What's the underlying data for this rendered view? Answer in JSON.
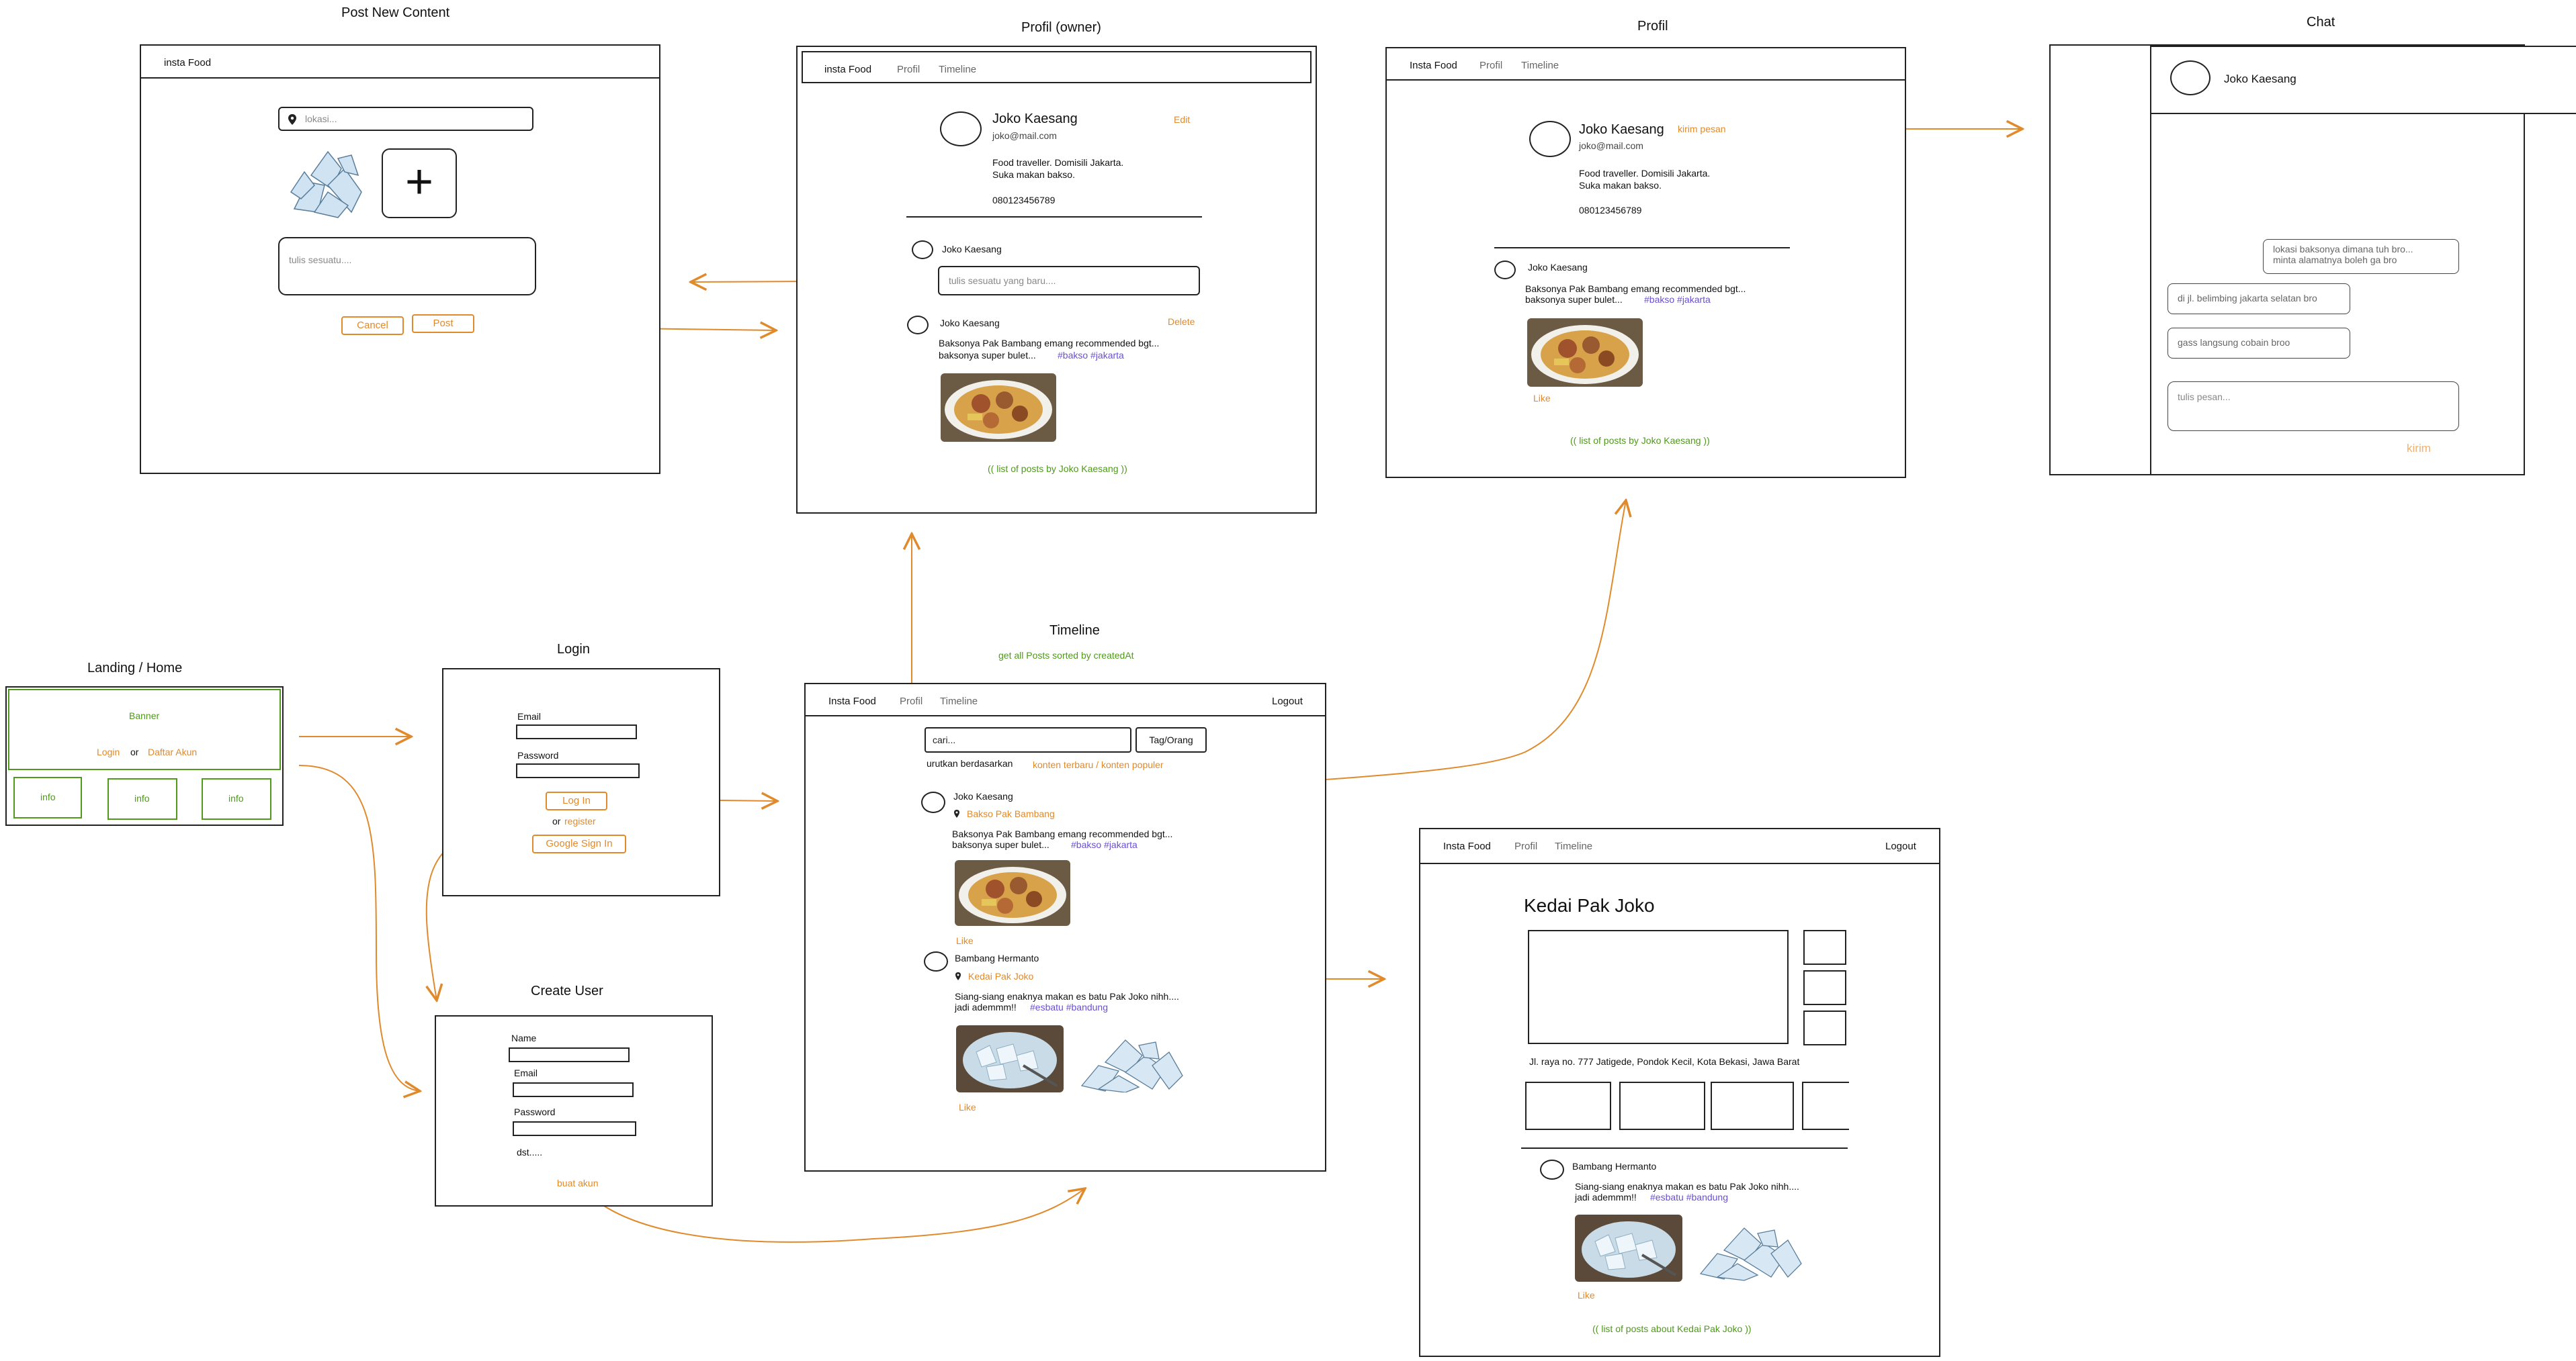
{
  "titles": {
    "post_new": "Post New Content",
    "profil_owner": "Profil (owner)",
    "profil": "Profil",
    "chat": "Chat",
    "landing": "Landing / Home",
    "login": "Login",
    "timeline": "Timeline",
    "timeline_note": "get all Posts sorted by createdAt",
    "create_user": "Create User"
  },
  "nav": {
    "brand_lower": "insta Food",
    "brand": "Insta Food",
    "profil": "Profil",
    "timeline": "Timeline",
    "logout": "Logout"
  },
  "post_new": {
    "location_placeholder": "lokasi...",
    "text_placeholder": "tulis sesuatu....",
    "plus": "+",
    "cancel": "Cancel",
    "post": "Post"
  },
  "profile": {
    "name": "Joko Kaesang",
    "email": "joko@mail.com",
    "bio1": "Food traveller. Domisili Jakarta.",
    "bio2": "Suka makan bakso.",
    "phone": "080123456789",
    "edit": "Edit",
    "kirim_pesan": "kirim pesan",
    "input_placeholder": "tulis sesuatu yang baru....",
    "delete": "Delete",
    "post_text1": "Baksonya Pak Bambang emang recommended bgt...",
    "post_text2": "baksonya super bulet...",
    "tags": "#bakso #jakarta",
    "like": "Like",
    "list_note": "(( list of posts by Joko Kaesang ))"
  },
  "chat": {
    "name": "Joko Kaesang",
    "msg1a": "lokasi baksonya dimana tuh bro...",
    "msg1b": "minta alamatnya boleh ga bro",
    "msg2": "di jl. belimbing jakarta selatan bro",
    "msg3": "gass langsung cobain broo",
    "input_placeholder": "tulis pesan...",
    "send": "kirim"
  },
  "landing": {
    "banner": "Banner",
    "login": "Login",
    "or": "or",
    "register": "Daftar Akun",
    "info": "info"
  },
  "login": {
    "email": "Email",
    "password": "Password",
    "login_btn": "Log In",
    "or": "or",
    "register": "register",
    "google": "Google Sign In"
  },
  "timeline": {
    "search_placeholder": "cari...",
    "tag_btn": "Tag/Orang",
    "sort_label": "urutkan berdasarkan",
    "sort_options": "konten terbaru / konten populer",
    "post1_user": "Joko Kaesang",
    "post1_loc": "Bakso Pak Bambang",
    "post1_text1": "Baksonya Pak Bambang emang recommended bgt...",
    "post1_text2": "baksonya super bulet...",
    "post1_tags": "#bakso #jakarta",
    "like": "Like",
    "post2_user": "Bambang Hermanto",
    "post2_loc": "Kedai Pak Joko",
    "post2_text1": "Siang-siang enaknya makan es batu Pak Joko nihh....",
    "post2_text2": "jadi ademmm!!",
    "post2_tags": "#esbatu #bandung"
  },
  "create_user": {
    "name": "Name",
    "email": "Email",
    "password": "Password",
    "etc": "dst.....",
    "submit": "buat akun"
  },
  "place": {
    "name": "Kedai Pak Joko",
    "address": "Jl. raya no. 777 Jatigede, Pondok Kecil, Kota Bekasi, Jawa Barat",
    "user": "Bambang Hermanto",
    "text1": "Siang-siang enaknya makan es batu Pak Joko nihh....",
    "text2": "jadi ademmm!!",
    "tags": "#esbatu #bandung",
    "like": "Like",
    "list_note": "(( list of posts about Kedai Pak Joko ))"
  },
  "colors": {
    "accent": "#e08a2c",
    "note": "#4f9a1a",
    "hashtag": "#6a4fd6",
    "line": "#222222"
  }
}
